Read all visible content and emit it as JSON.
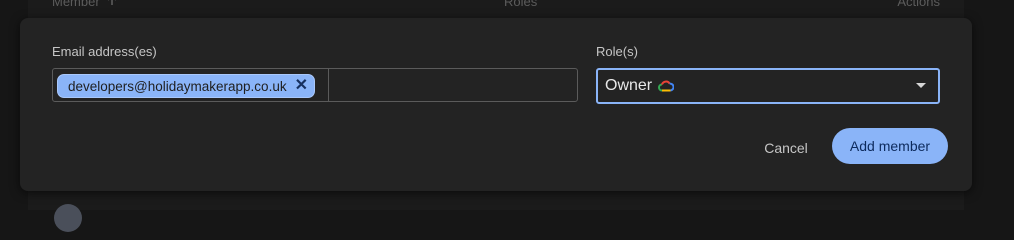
{
  "background_table": {
    "header_member": "Member",
    "header_roles": "Roles",
    "header_actions": "Actions"
  },
  "dialog": {
    "email_label": "Email address(es)",
    "email_chips": [
      {
        "value": "developers@holidaymakerapp.co.uk",
        "remove_icon": "close-icon"
      }
    ],
    "email_input_value": "",
    "role_label": "Role(s)",
    "role_selected": "Owner",
    "role_icon": "google-cloud-icon",
    "cancel_label": "Cancel",
    "add_label": "Add member"
  },
  "colors": {
    "accent": "#8ab4f8",
    "dialog_bg": "#232323",
    "page_bg": "#161616"
  }
}
